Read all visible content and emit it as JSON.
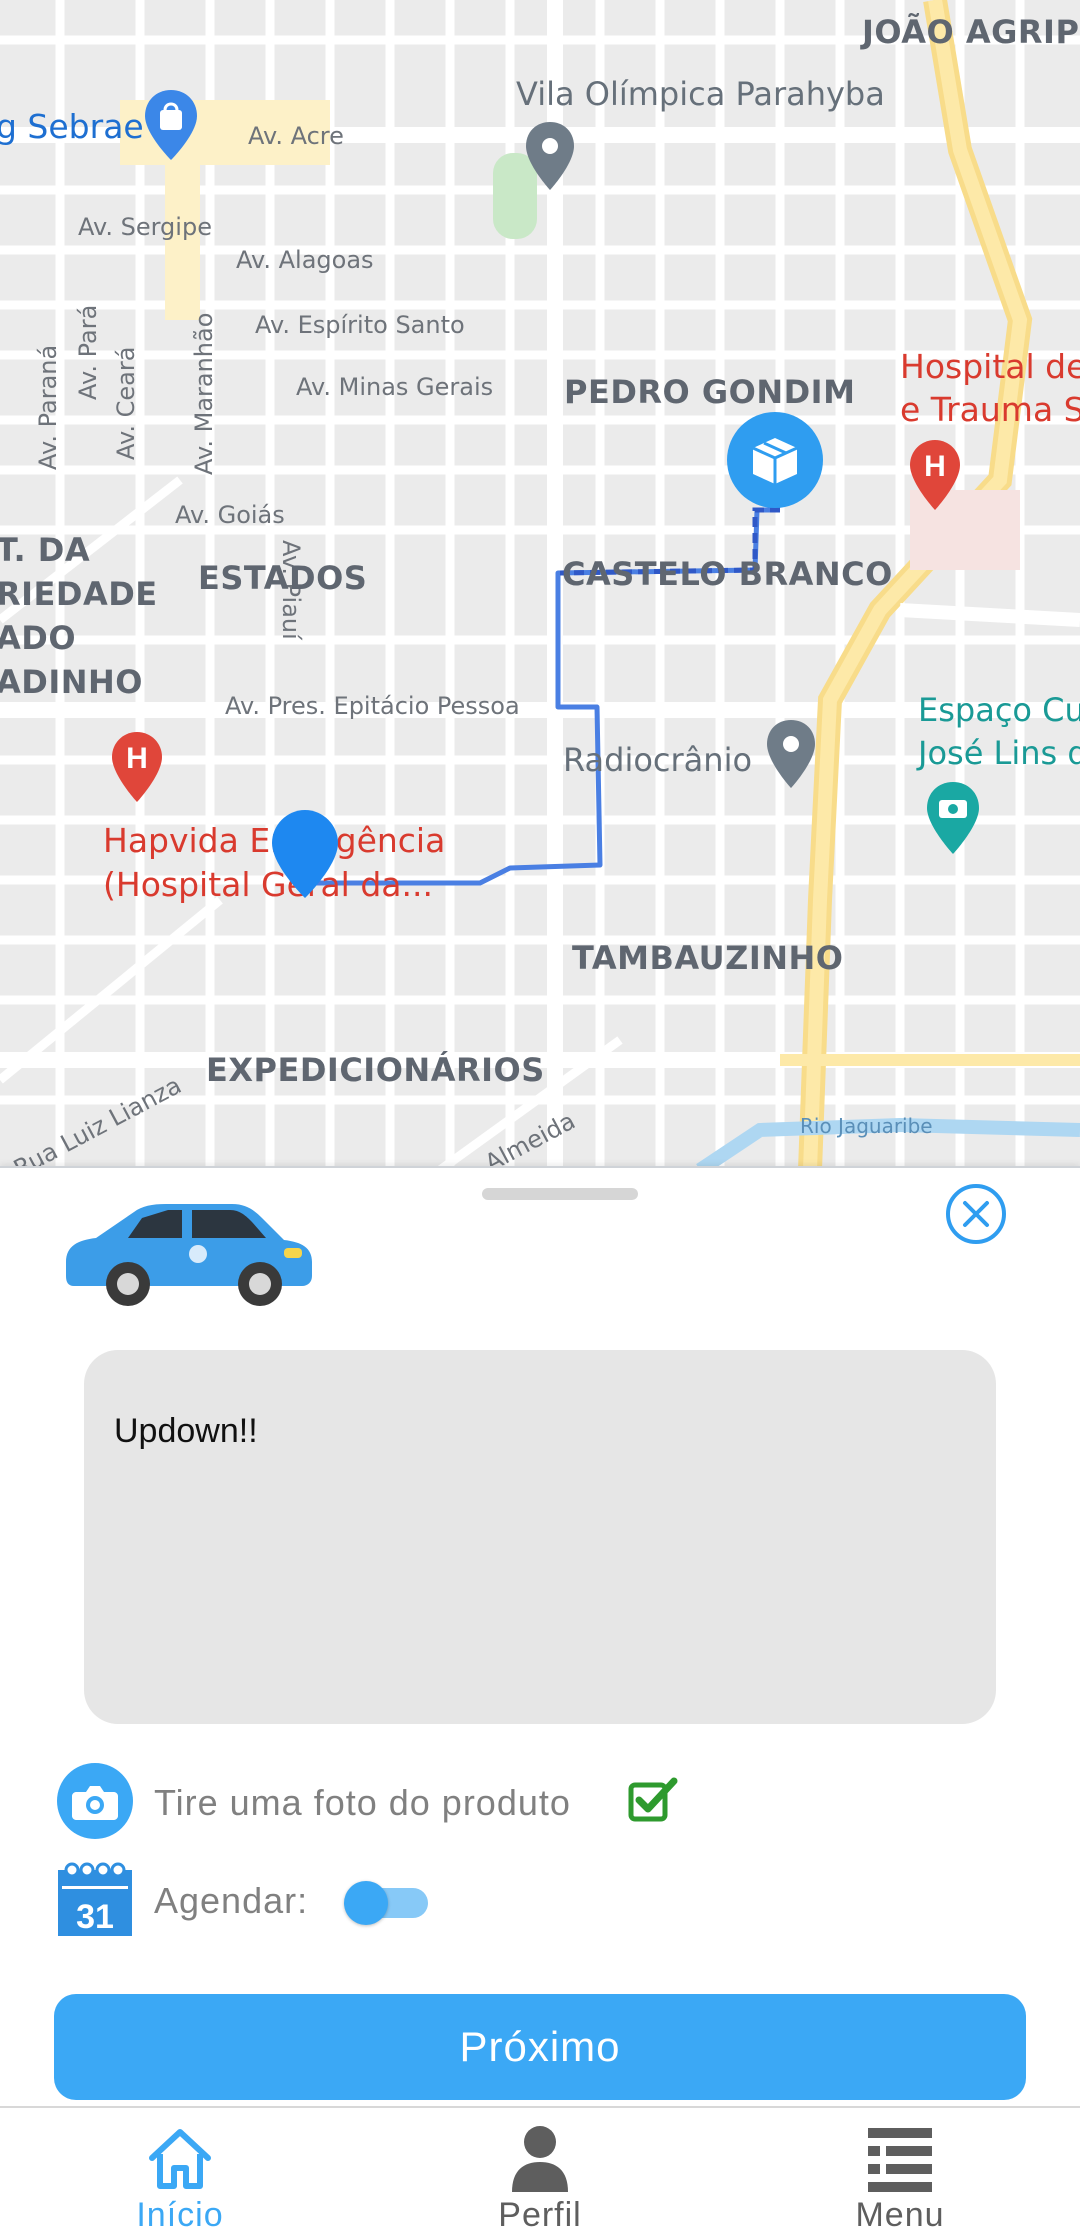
{
  "map": {
    "labels": {
      "joao_agripino": "JOÃO AGRIPI",
      "vila_olimpica": "Vila Olímpica Parahyba",
      "sebrae": "g Sebrae",
      "av_acre": "Av. Acre",
      "av_sergipe": "Av. Sergipe",
      "av_alagoas": "Av. Alagoas",
      "av_espirito_santo": "Av. Espírito Santo",
      "av_minas_gerais": "Av. Minas Gerais",
      "av_parana": "Av. Paraná",
      "av_para": "Av. Pará",
      "av_ceara": "Av. Ceará",
      "av_maranhao": "Av. Maranhão",
      "av_piaui": "Av. Piauí",
      "av_goias": "Av. Goiás",
      "pedro_gondim": "PEDRO GONDIM",
      "hospital_trauma_1": "Hospital de",
      "hospital_trauma_2": "e Trauma S",
      "t_da": "T. DA",
      "riedade": "RIEDADE",
      "ado": "ADO",
      "adinho": "ADINHO",
      "estados": "ESTADOS",
      "castelo_branco": "CASTELO BRANCO",
      "av_epitacio": "Av. Pres. Epitácio Pessoa",
      "espaco_cu": "Espaço Cu",
      "jose_lins": "José Lins d",
      "radiocranio": "Radiocrânio",
      "hapvida_1": "Hapvida Emergência",
      "hapvida_2": "(Hospital Geral da...",
      "tambauzinho": "TAMBAUZINHO",
      "expedicionarios": "EXPEDICIONÁRIOS",
      "rua_luiz_lianza": "Rua Luiz Lianza",
      "almeida": "de Almeida",
      "rio_jaguaribe": "Rio Jaguaribe"
    },
    "hospital_letter": "H"
  },
  "sheet": {
    "note_text": "Updown!!",
    "photo_label": "Tire uma foto do produto",
    "photo_checked": true,
    "schedule_label": "Agendar:",
    "schedule_toggle_on": false,
    "calendar_day": "31",
    "next_button": "Próximo"
  },
  "nav": {
    "items": [
      {
        "label": "Início",
        "icon": "home-icon",
        "active": true
      },
      {
        "label": "Perfil",
        "icon": "person-icon",
        "active": false
      },
      {
        "label": "Menu",
        "icon": "menu-icon",
        "active": false
      }
    ]
  },
  "colors": {
    "accent": "#3ba8f5",
    "nav_active": "#3ba8f5",
    "nav_inactive": "#5e5e5e",
    "route": "#4a7fe3",
    "check_green": "#2e9a2e",
    "hospital_red": "#d93a2e"
  }
}
